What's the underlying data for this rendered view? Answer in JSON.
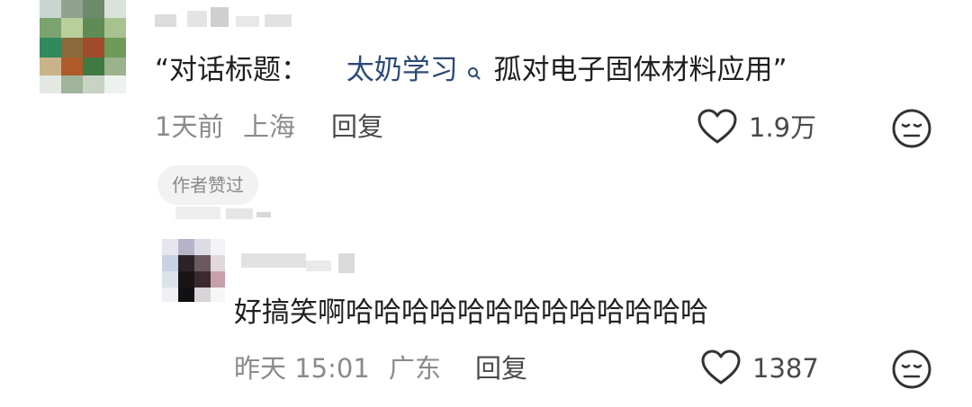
{
  "comment": {
    "text_prefix": "“对话标题：",
    "link_text": "太奶学习",
    "text_suffix": "孤对电子固体材料应用”",
    "time": "1天前",
    "location": "上海",
    "reply_label": "回复",
    "like_count": "1.9万",
    "author_badge": "作者赞过"
  },
  "reply": {
    "text": "好搞笑啊哈哈哈哈哈哈哈哈哈哈哈哈哈",
    "time": "昨天 15:01",
    "location": "广东",
    "reply_label": "回复",
    "like_count": "1387"
  },
  "icons": {
    "like": "heart-outline-icon",
    "reaction": "neutral-face-icon",
    "search": "search-icon"
  }
}
